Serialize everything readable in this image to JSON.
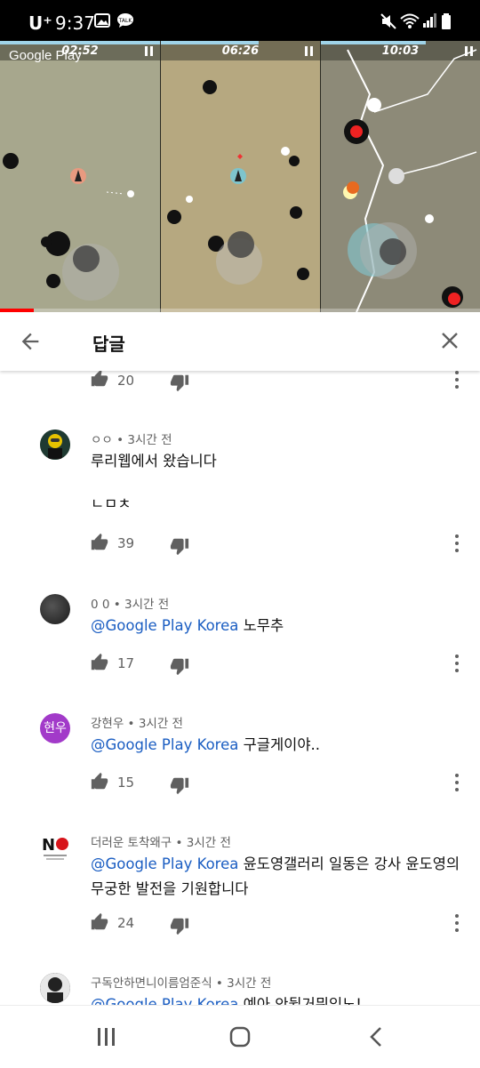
{
  "status_bar": {
    "carrier": "U⁺",
    "time": "9:37"
  },
  "video": {
    "watermark": "Google Play",
    "timers": [
      "02:52",
      "06:26",
      "10:03"
    ]
  },
  "header": {
    "title": "답글"
  },
  "top_row": {
    "likes": "20"
  },
  "comments": [
    {
      "author": "ㅇㅇ",
      "time": "3시간 전",
      "mention": "",
      "text": "루리웹에서 왔습니다",
      "text2": "ㄴㅁㅊ",
      "likes": "39"
    },
    {
      "author": "0 0",
      "time": "3시간 전",
      "mention": "@Google Play Korea",
      "text": "노무추",
      "likes": "17"
    },
    {
      "author": "강현우",
      "time": "3시간 전",
      "avatar_text": "현우",
      "mention": "@Google Play Korea",
      "text": "구글게이야..",
      "likes": "15"
    },
    {
      "author": "더러운 토착왜구",
      "time": "3시간 전",
      "avatar_text": "NO",
      "mention": "@Google Play Korea",
      "text": "윤도영갤러리 일동은 강사 윤도영의",
      "text_line2": "무궁한 발전을 기원합니다",
      "likes": "24"
    },
    {
      "author": "구독안하면니이름엄준식",
      "time": "3시간 전",
      "mention": "@Google Play Korea",
      "text": "예아 안뒬거뭐있노!"
    }
  ],
  "colors": {
    "mention": "#1a5dc2",
    "avatar_purple": "#a23ac9",
    "video_progress": "#ff0000"
  }
}
